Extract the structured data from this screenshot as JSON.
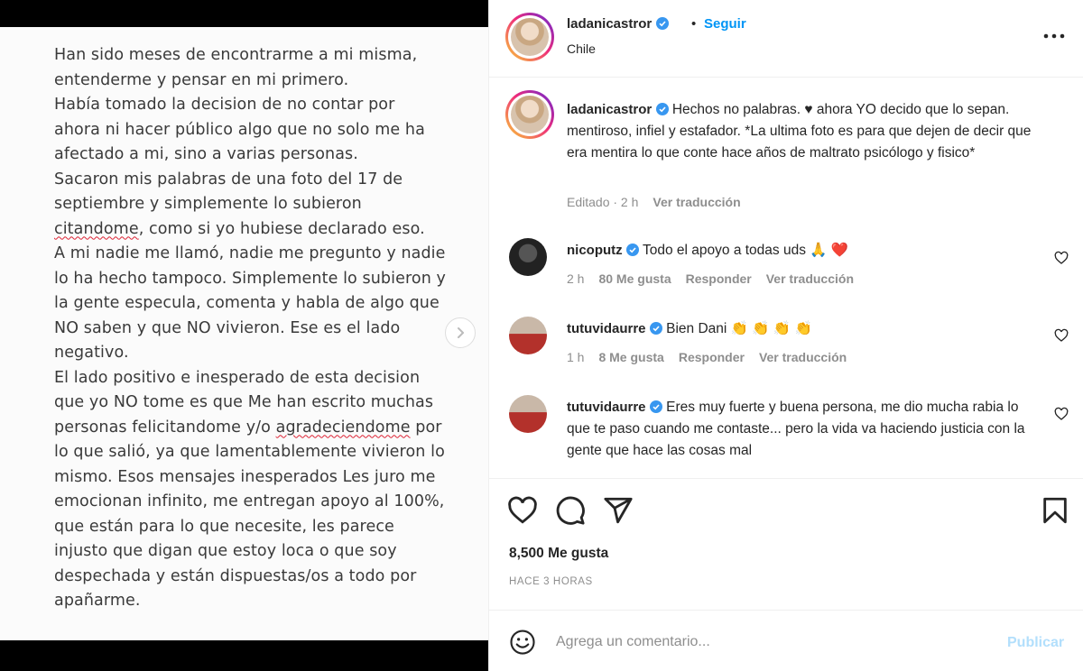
{
  "post_image": {
    "lines": [
      "Han sido meses de encontrarme a mi misma,",
      "entenderme y pensar en mi primero.",
      "Había tomado la decision de no contar por",
      "ahora ni hacer público algo que no solo me ha",
      "afectado a mi, sino a varias personas.",
      "Sacaron mis palabras de una foto del 17 de",
      "septiembre y simplemente lo subieron",
      ", como si yo hubiese declarado eso.",
      " A mi nadie me llamó, nadie me pregunto y nadie",
      "lo ha hecho tampoco. Simplemente lo subieron y",
      "la gente especula, comenta y habla de algo que",
      "NO saben y que NO vivieron. Ese es el lado",
      "negativo.",
      "El lado positivo e inesperado de esta decision",
      "que yo NO tome es que Me han escrito muchas",
      "personas felicitandome y/o ",
      " por",
      "lo que salió, ya que lamentablemente vivieron lo",
      "mismo. Esos mensajes inesperados Les juro me",
      "emocionan infinito, me entregan apoyo al 100%,",
      "que están para lo que necesite, les parece",
      "injusto que digan que estoy loca o que soy",
      "despechada y están dispuestas/os a todo por",
      "apañarme."
    ],
    "underlined_1": "citandome",
    "underlined_2": "agradeciendome"
  },
  "header": {
    "username": "ladanicastror",
    "dot": "•",
    "follow_label": "Seguir",
    "location": "Chile"
  },
  "caption": {
    "username": "ladanicastror",
    "text": " Hechos no palabras. ♥ ahora YO decido que lo sepan. mentiroso, infiel y estafador. *La ultima foto es para que dejen de decir que era mentira lo que conte hace años de maltrato psicólogo y fisico*",
    "edited": "Editado · 2 h",
    "translate": "Ver traducción"
  },
  "comments": [
    {
      "username": "nicoputz",
      "text": " Todo el apoyo a todas uds 🙏 ❤️",
      "time": "2 h",
      "likes": "80 Me gusta",
      "reply": "Responder",
      "translate": "Ver traducción"
    },
    {
      "username": "tutuvidaurre",
      "text": " Bien Dani 👏 👏 👏 👏",
      "time": "1 h",
      "likes": "8 Me gusta",
      "reply": "Responder",
      "translate": "Ver traducción"
    },
    {
      "username": "tutuvidaurre",
      "text": " Eres muy fuerte y buena persona, me dio mucha rabia lo que te paso cuando me contaste... pero la vida va haciendo justicia con la gente que hace las cosas mal"
    }
  ],
  "actions": {
    "likes": "8,500 Me gusta",
    "time_ago": "HACE 3 HORAS"
  },
  "add_comment": {
    "placeholder": "Agrega un comentario...",
    "publish": "Publicar"
  },
  "colors": {
    "accent": "#0095f6",
    "publish_disabled": "#b2dffc",
    "verified": "#3897f0"
  }
}
